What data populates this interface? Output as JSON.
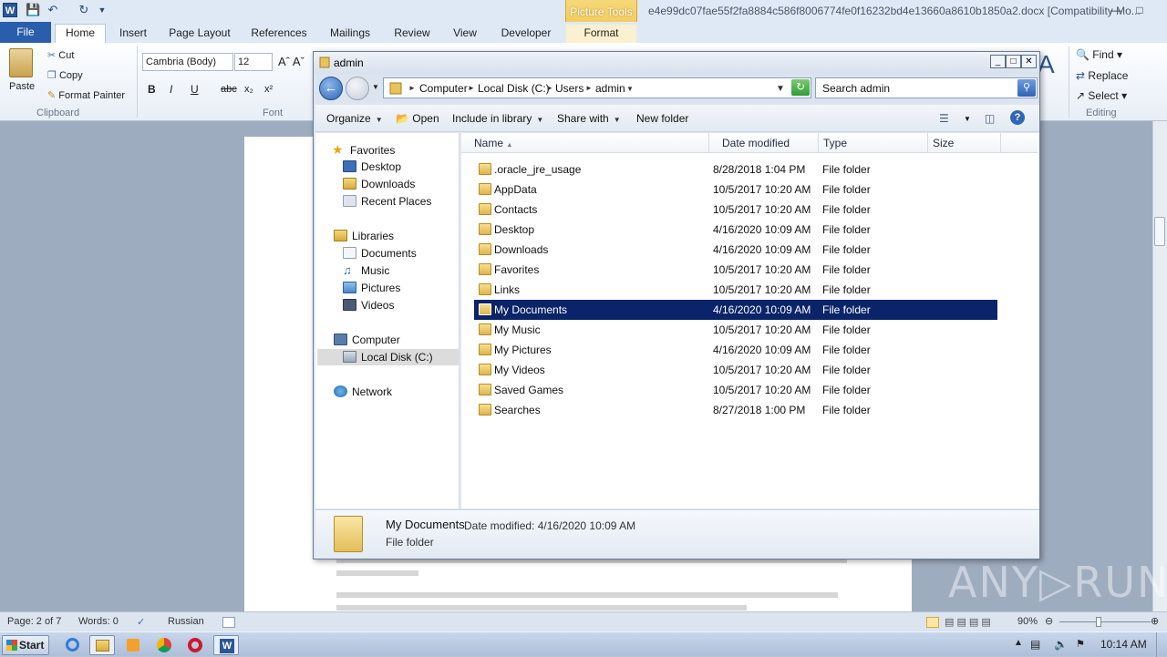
{
  "word": {
    "title": "e4e99dc07fae55f2fa8884c586f8006774fe0f16232bd4e13660a8610b1850a2.docx [Compatibility Mo...",
    "picture_tools_label": "Picture Tools",
    "tabs": [
      "File",
      "Home",
      "Insert",
      "Page Layout",
      "References",
      "Mailings",
      "Review",
      "View",
      "Developer",
      "Format"
    ],
    "clipboard": {
      "paste": "Paste",
      "cut": "Cut",
      "copy": "Copy",
      "format_painter": "Format Painter",
      "group": "Clipboard"
    },
    "font": {
      "name": "Cambria (Body)",
      "size": "12",
      "group": "Font"
    },
    "editing": {
      "find": "Find",
      "replace": "Replace",
      "select": "Select",
      "group": "Editing",
      "change_styles_partial": "ange\nles"
    },
    "status": {
      "page": "Page: 2 of 7",
      "words": "Words: 0",
      "language": "Russian",
      "zoom": "90%"
    }
  },
  "explorer": {
    "title": "admin",
    "breadcrumb": [
      "Computer",
      "Local Disk (C:)",
      "Users",
      "admin"
    ],
    "search_placeholder": "Search admin",
    "toolbar": {
      "organize": "Organize",
      "open": "Open",
      "include": "Include in library",
      "share": "Share with",
      "new_folder": "New folder"
    },
    "nav": {
      "favorites": "Favorites",
      "desktop": "Desktop",
      "downloads": "Downloads",
      "recent": "Recent Places",
      "libraries": "Libraries",
      "documents": "Documents",
      "music": "Music",
      "pictures": "Pictures",
      "videos": "Videos",
      "computer": "Computer",
      "local_disk": "Local Disk (C:)",
      "network": "Network"
    },
    "columns": {
      "name": "Name",
      "date": "Date modified",
      "type": "Type",
      "size": "Size"
    },
    "rows": [
      {
        "name": ".oracle_jre_usage",
        "date": "8/28/2018 1:04 PM",
        "type": "File folder"
      },
      {
        "name": "AppData",
        "date": "10/5/2017 10:20 AM",
        "type": "File folder"
      },
      {
        "name": "Contacts",
        "date": "10/5/2017 10:20 AM",
        "type": "File folder"
      },
      {
        "name": "Desktop",
        "date": "4/16/2020 10:09 AM",
        "type": "File folder"
      },
      {
        "name": "Downloads",
        "date": "4/16/2020 10:09 AM",
        "type": "File folder"
      },
      {
        "name": "Favorites",
        "date": "10/5/2017 10:20 AM",
        "type": "File folder"
      },
      {
        "name": "Links",
        "date": "10/5/2017 10:20 AM",
        "type": "File folder"
      },
      {
        "name": "My Documents",
        "date": "4/16/2020 10:09 AM",
        "type": "File folder"
      },
      {
        "name": "My Music",
        "date": "10/5/2017 10:20 AM",
        "type": "File folder"
      },
      {
        "name": "My Pictures",
        "date": "4/16/2020 10:09 AM",
        "type": "File folder"
      },
      {
        "name": "My Videos",
        "date": "10/5/2017 10:20 AM",
        "type": "File folder"
      },
      {
        "name": "Saved Games",
        "date": "10/5/2017 10:20 AM",
        "type": "File folder"
      },
      {
        "name": "Searches",
        "date": "8/27/2018 1:00 PM",
        "type": "File folder"
      }
    ],
    "details": {
      "name": "My Documents",
      "date_label": "Date modified: 4/16/2020 10:09 AM",
      "type": "File folder"
    }
  },
  "taskbar": {
    "start": "Start",
    "clock": "10:14 AM"
  },
  "watermark": "ANY▷RUN"
}
